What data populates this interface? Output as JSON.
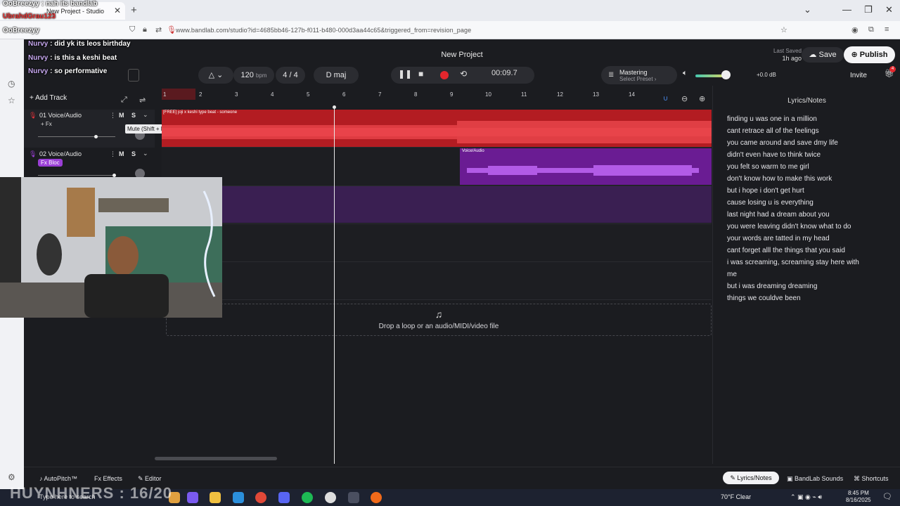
{
  "browser": {
    "tab_title": "New Project - Studio",
    "new_tab": "+",
    "url": "www.bandlab.com/studio?id=4685bb46-127b-f011-b480-000d3aa44c65&triggered_from=revision_page",
    "window_controls": [
      "⌄",
      "—",
      "❐",
      "✕"
    ]
  },
  "chat": {
    "top_line": "OoBreezyy : nah its bandlab",
    "top_user": "UbrahdGrau123",
    "mid_user": "OoBreezyy",
    "messages": [
      {
        "user": "Nurvy",
        "text": " : did yk its leos birthday"
      },
      {
        "user": "Nurvy",
        "text": " : is this a keshi beat"
      },
      {
        "user": "Nurvy",
        "text": " : so performative"
      }
    ]
  },
  "app": {
    "project_title": "New Project",
    "last_saved_label": "Last Saved",
    "last_saved_value": "1h ago",
    "save": "Save",
    "publish": "Publish",
    "bpm_value": "120",
    "bpm_unit": "bpm",
    "time_signature": "4 / 4",
    "key": "D maj",
    "time": "00:09.7",
    "mastering_title": "Mastering",
    "mastering_preset": "Select Preset ›",
    "volume_db": "+0.0 dB",
    "volume_level": 0.85,
    "invite": "Invite",
    "gift_badge": "4",
    "add_track": "Add Track",
    "tooltip": "Mute (Shift + M)"
  },
  "tracks": [
    {
      "number": "01",
      "name": "Voice/Audio",
      "fx": "+ Fx",
      "mute": "M",
      "solo": "S",
      "color": "#e0323a"
    },
    {
      "number": "02",
      "name": "Voice/Audio",
      "fx": "Fx Bloc",
      "mute": "M",
      "solo": "S",
      "color": "#9b3fd6"
    }
  ],
  "ruler": [
    "1",
    "2",
    "3",
    "4",
    "5",
    "6",
    "7",
    "8",
    "9",
    "10",
    "11",
    "12",
    "13",
    "14"
  ],
  "clips": {
    "red_label": "[FREE] joji x keshi type beat - someone",
    "purple_label": "Voice/Audio"
  },
  "drop_zone": "Drop a loop or an audio/MIDI/video file",
  "lyrics": {
    "title": "Lyrics/Notes",
    "lines": [
      "finding u was one in a million",
      "cant retrace all of the feelings",
      "you came around and save dmy life",
      "didn't even have to think twice",
      "you felt so warm to me girl",
      "don't know how to make this work",
      "but i hope i don't get hurt",
      "cause losing u is everything",
      "last night had a dream about you",
      "you were leaving didn't know what to do",
      "your words are tatted in my head",
      "cant forget alll the things that you said",
      "i was screaming, screaming stay here with",
      "me",
      "but i was dreaming dreaming",
      "things we couldve been"
    ]
  },
  "bottom": {
    "autopitch": "AutoPitch™",
    "effects": "Effects",
    "editor": "Editor",
    "lyrics_notes": "Lyrics/Notes",
    "bandlab_sounds": "BandLab Sounds",
    "shortcuts": "Shortcuts"
  },
  "taskbar": {
    "overlay": "HUYNHNERS : 16/20",
    "search": "Type here to search",
    "weather": "70°F  Clear",
    "time": "8:45 PM",
    "date": "8/16/2025"
  }
}
